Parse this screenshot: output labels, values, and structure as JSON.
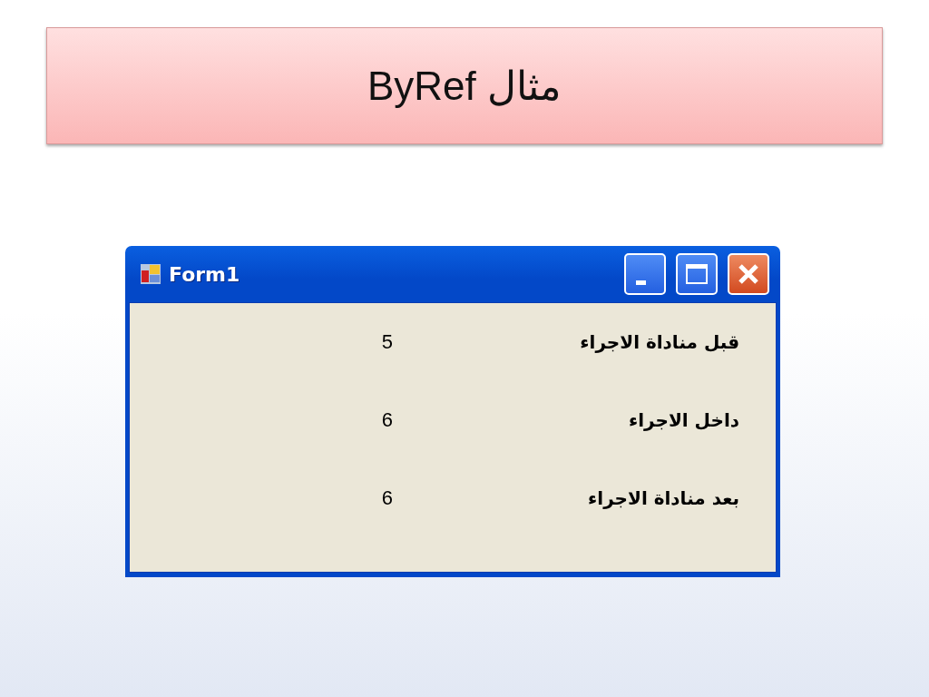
{
  "slide_title": "مثال ByRef",
  "window": {
    "title": "Form1"
  },
  "rows": [
    {
      "label": "قبل مناداة الاجراء",
      "value": "5"
    },
    {
      "label": "داخل الاجراء",
      "value": "6"
    },
    {
      "label": "بعد مناداة الاجراء",
      "value": "6"
    }
  ]
}
